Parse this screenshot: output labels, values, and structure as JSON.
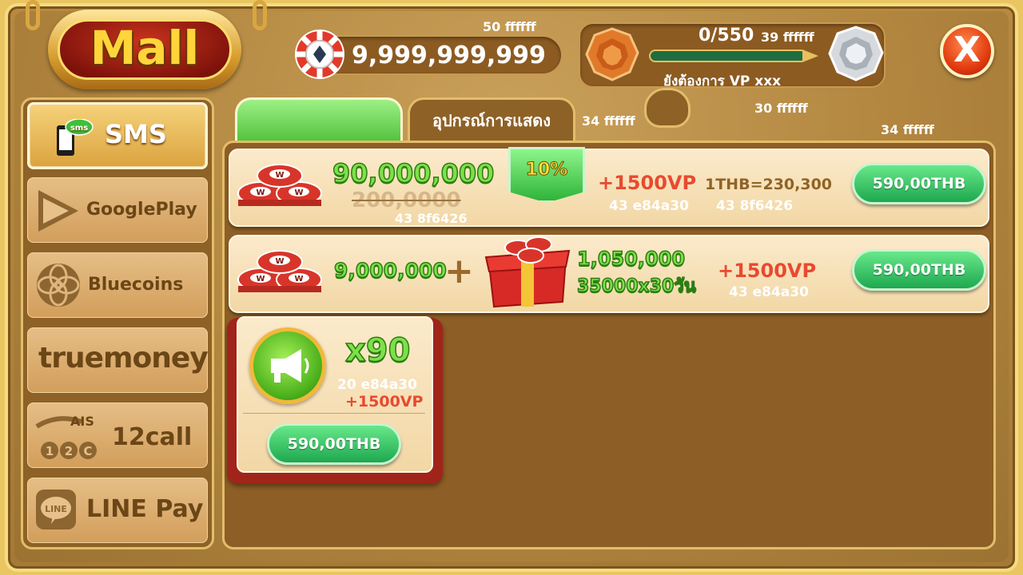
{
  "app": {
    "title": "Mall",
    "close_label": "X"
  },
  "balance": {
    "value": "9,999,999,999",
    "note": "50 ffffff"
  },
  "vp": {
    "progress_text": "0/550",
    "progress_note": "39 ffffff",
    "progress": 0,
    "message": "ยังต้องการ VP xxx"
  },
  "tabs": [
    {
      "label": ""
    },
    {
      "label": "อุปกรณ์การแสดง"
    }
  ],
  "tab_notes": {
    "a": "34 ffffff",
    "b": "30 ffffff",
    "c": "34 ffffff"
  },
  "sidebar": {
    "items": [
      {
        "label": "SMS",
        "icon": "sms-phone-icon",
        "selected": true,
        "badge": "sms"
      },
      {
        "label": "GooglePlay",
        "icon": "google-play-icon"
      },
      {
        "label": "Bluecoins",
        "icon": "bluecoins-icon"
      },
      {
        "label": "truemoney",
        "icon": "truemoney-logo"
      },
      {
        "label": "12call",
        "icon": "ais-12call-logo",
        "sub_label": "AIS"
      },
      {
        "label": "LINE Pay",
        "icon": "line-pay-icon",
        "sub_label": "LINE"
      }
    ]
  },
  "offers": [
    {
      "amount": "90,000,000",
      "old_amount": "200,0000",
      "old_note": "43 8f6426",
      "discount": "10%",
      "vp": "+1500VP",
      "vp_note": "43 e84a30",
      "rate": "1THB=230,300",
      "rate_note": "43 8f6426",
      "price": "590,00THB"
    },
    {
      "amount": "9,000,000",
      "plus": "+",
      "bonus_amount": "1,050,000",
      "bonus_detail": "35000x30วัน",
      "vp": "+1500VP",
      "vp_note": "43 e84a30",
      "price": "590,00THB"
    }
  ],
  "card": {
    "quantity": "x90",
    "note": "20 e84a30",
    "vp": "+1500VP",
    "price": "590,00THB"
  },
  "colors": {
    "accent_green": "#1ea84f",
    "vp_red": "#e84a30",
    "brown_text": "#8f6426",
    "logo_red": "#a01e06"
  }
}
